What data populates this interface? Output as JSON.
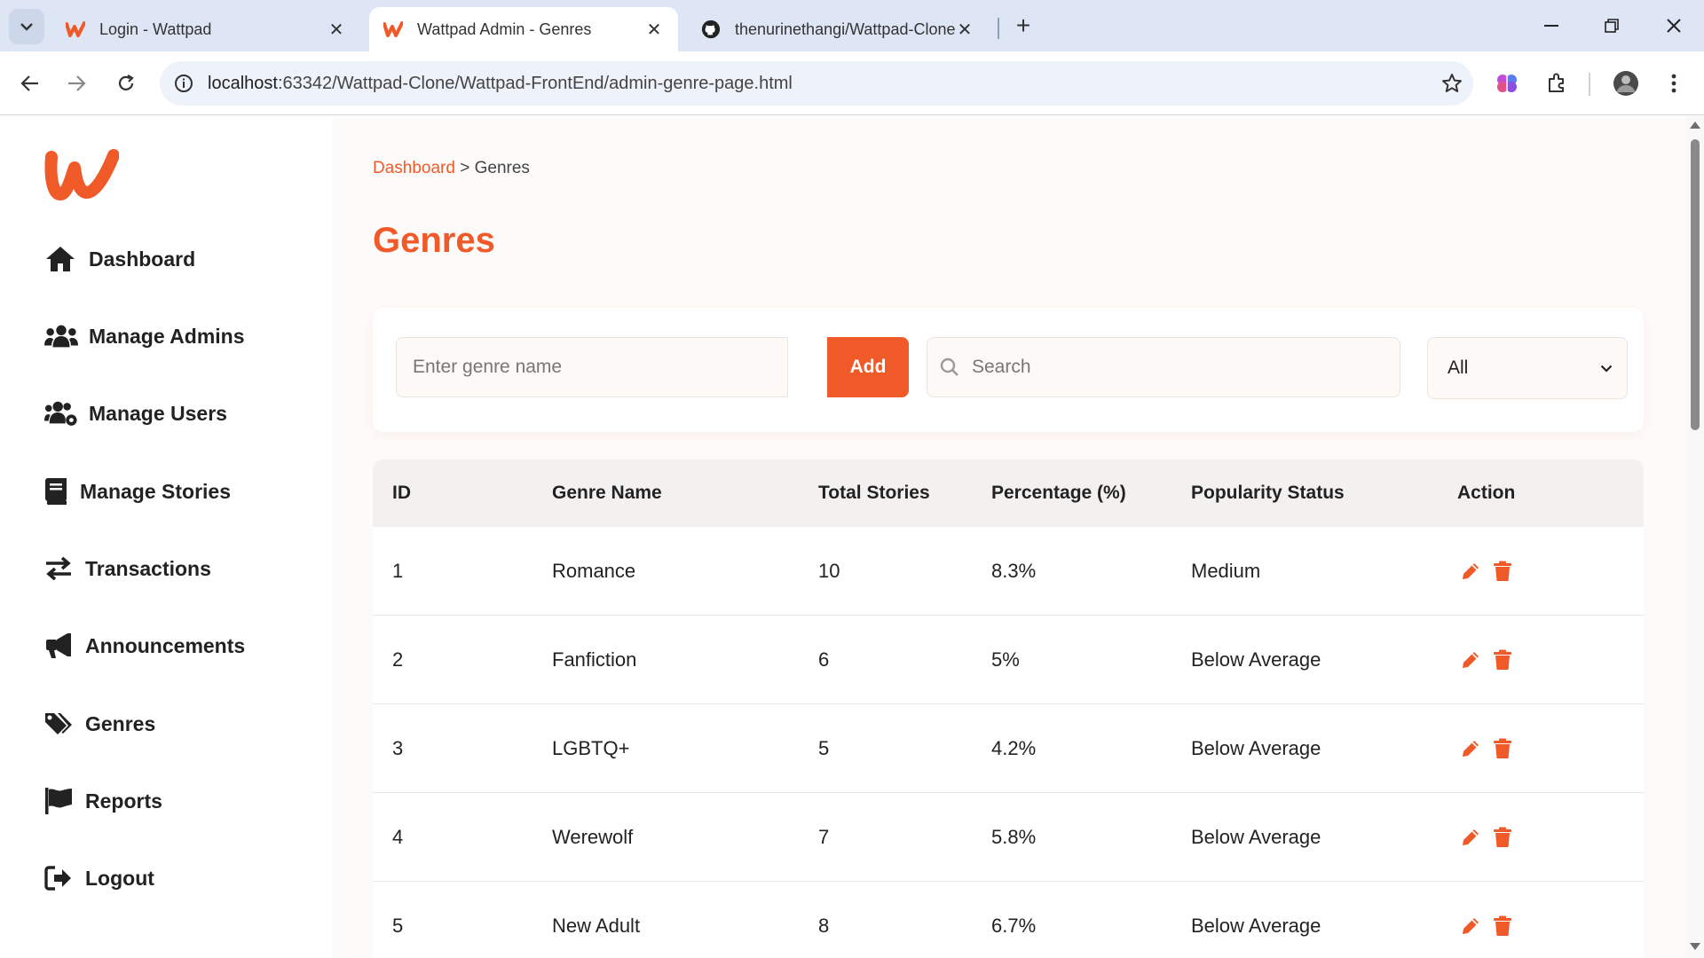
{
  "browser": {
    "tabs": [
      {
        "title": "Login - Wattpad",
        "active": false,
        "icon": "wattpad-icon"
      },
      {
        "title": "Wattpad Admin - Genres",
        "active": true,
        "icon": "wattpad-icon"
      },
      {
        "title": "thenurinethangi/Wattpad-Clone",
        "active": false,
        "icon": "github-icon"
      }
    ],
    "url_host": "localhost",
    "url_path": ":63342/Wattpad-Clone/Wattpad-FrontEnd/admin-genre-page.html"
  },
  "sidebar": {
    "items": [
      {
        "label": "Dashboard",
        "icon": "home-icon"
      },
      {
        "label": "Manage Admins",
        "icon": "users-icon"
      },
      {
        "label": "Manage Users",
        "icon": "users-cog-icon"
      },
      {
        "label": "Manage Stories",
        "icon": "book-icon"
      },
      {
        "label": "Transactions",
        "icon": "exchange-icon"
      },
      {
        "label": "Announcements",
        "icon": "bullhorn-icon"
      },
      {
        "label": "Genres",
        "icon": "tags-icon"
      },
      {
        "label": "Reports",
        "icon": "flag-icon"
      },
      {
        "label": "Logout",
        "icon": "logout-icon"
      }
    ]
  },
  "main": {
    "breadcrumb": {
      "link": "Dashboard",
      "separator": ">",
      "current": "Genres"
    },
    "title": "Genres",
    "genre_input_placeholder": "Enter genre name",
    "add_label": "Add",
    "search_placeholder": "Search",
    "filter_selected": "All"
  },
  "table": {
    "headers": [
      "ID",
      "Genre Name",
      "Total Stories",
      "Percentage (%)",
      "Popularity Status",
      "Action"
    ],
    "rows": [
      {
        "id": "1",
        "name": "Romance",
        "total": "10",
        "pct": "8.3%",
        "status": "Medium"
      },
      {
        "id": "2",
        "name": "Fanfiction",
        "total": "6",
        "pct": "5%",
        "status": "Below Average"
      },
      {
        "id": "3",
        "name": "LGBTQ+",
        "total": "5",
        "pct": "4.2%",
        "status": "Below Average"
      },
      {
        "id": "4",
        "name": "Werewolf",
        "total": "7",
        "pct": "5.8%",
        "status": "Below Average"
      },
      {
        "id": "5",
        "name": "New Adult",
        "total": "8",
        "pct": "6.7%",
        "status": "Below Average"
      }
    ]
  },
  "colors": {
    "accent": "#f05a28",
    "text": "#222222",
    "chrome": "#dee6f5"
  }
}
